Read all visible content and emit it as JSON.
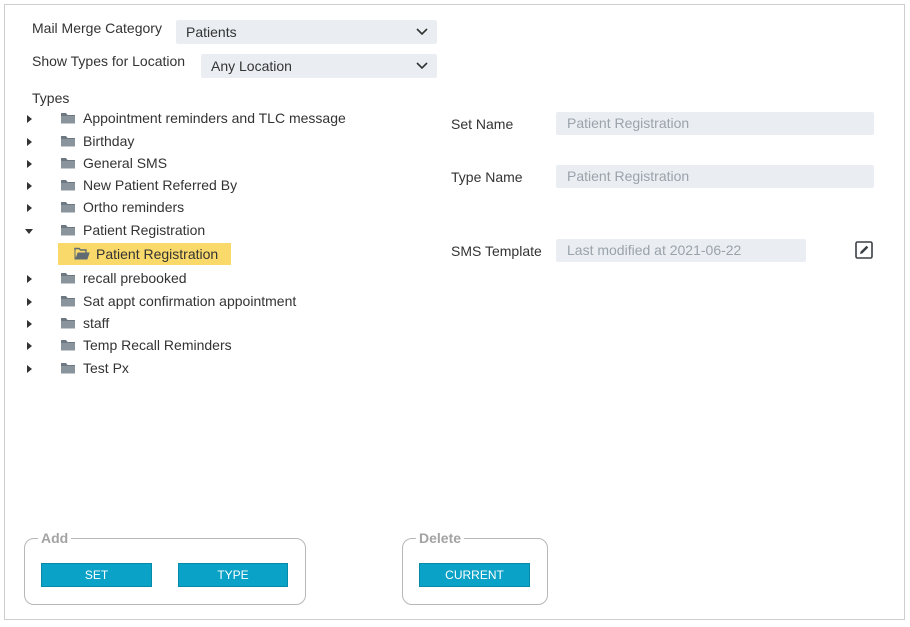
{
  "filters": {
    "category_label": "Mail Merge Category",
    "category_value": "Patients",
    "location_label": "Show Types for Location",
    "location_value": "Any Location"
  },
  "tree": {
    "title": "Types",
    "items": [
      {
        "label": "Appointment reminders and TLC message",
        "expanded": false
      },
      {
        "label": "Birthday",
        "expanded": false
      },
      {
        "label": "General SMS",
        "expanded": false
      },
      {
        "label": "New Patient Referred By",
        "expanded": false
      },
      {
        "label": "Ortho reminders",
        "expanded": false
      },
      {
        "label": "Patient Registration",
        "expanded": true
      },
      {
        "label": "recall prebooked",
        "expanded": false
      },
      {
        "label": "Sat appt confirmation appointment",
        "expanded": false
      },
      {
        "label": "staff",
        "expanded": false
      },
      {
        "label": "Temp Recall Reminders",
        "expanded": false
      },
      {
        "label": "Test Px",
        "expanded": false
      }
    ],
    "selected_child": "Patient Registration"
  },
  "details": {
    "set_name_label": "Set Name",
    "set_name_value": "Patient Registration",
    "type_name_label": "Type Name",
    "type_name_value": "Patient Registration",
    "sms_template_label": "SMS Template",
    "sms_template_value": "Last modified at 2021-06-22"
  },
  "actions": {
    "add_legend": "Add",
    "set_button": "SET",
    "type_button": "TYPE",
    "delete_legend": "Delete",
    "current_button": "CURRENT"
  },
  "colors": {
    "accent": "#0aa2c6",
    "selection": "#f9d96a",
    "field_bg": "#eaeef2"
  },
  "icons": {
    "folder": "folder-icon",
    "caret_right": "caret-right-icon",
    "caret_down": "caret-down-icon",
    "chevron": "chevron-down-icon",
    "edit": "edit-icon"
  }
}
